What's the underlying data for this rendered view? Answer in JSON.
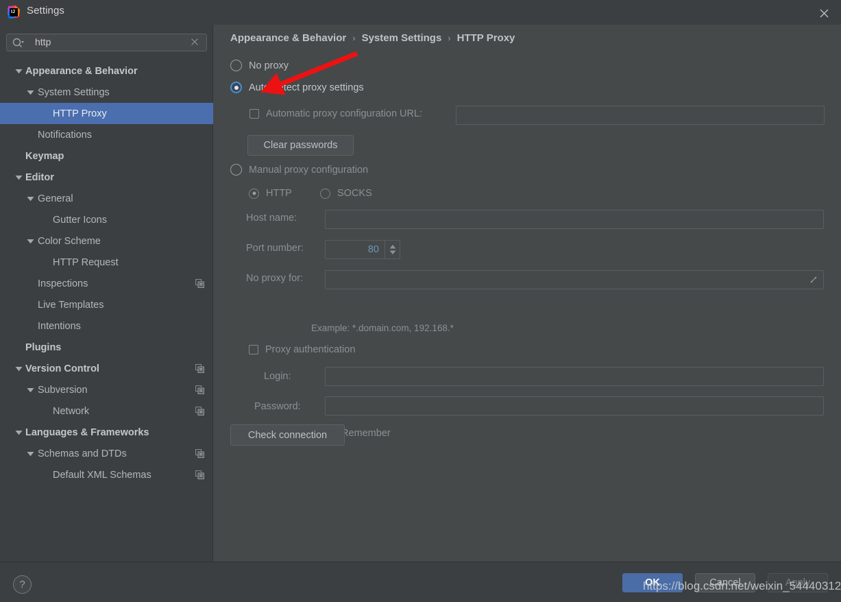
{
  "window": {
    "title": "Settings",
    "logo_icon": "intellij-idea-logo",
    "close_icon": "close-icon"
  },
  "search": {
    "value": "http",
    "placeholder": "",
    "search_icon": "search-icon",
    "clear_icon": "clear-icon"
  },
  "sidebar": {
    "items": [
      {
        "label": "Appearance & Behavior",
        "indent": 0,
        "twisty": "expanded",
        "bold": true,
        "selected": false,
        "copy": false
      },
      {
        "label": "System Settings",
        "indent": 1,
        "twisty": "expanded",
        "bold": false,
        "selected": false,
        "copy": false
      },
      {
        "label": "HTTP Proxy",
        "indent": 2,
        "twisty": "none",
        "bold": false,
        "selected": true,
        "copy": false
      },
      {
        "label": "Notifications",
        "indent": 1,
        "twisty": "none",
        "bold": false,
        "selected": false,
        "copy": false
      },
      {
        "label": "Keymap",
        "indent": 0,
        "twisty": "none",
        "bold": true,
        "selected": false,
        "copy": false
      },
      {
        "label": "Editor",
        "indent": 0,
        "twisty": "expanded",
        "bold": true,
        "selected": false,
        "copy": false
      },
      {
        "label": "General",
        "indent": 1,
        "twisty": "expanded",
        "bold": false,
        "selected": false,
        "copy": false
      },
      {
        "label": "Gutter Icons",
        "indent": 2,
        "twisty": "none",
        "bold": false,
        "selected": false,
        "copy": false
      },
      {
        "label": "Color Scheme",
        "indent": 1,
        "twisty": "expanded",
        "bold": false,
        "selected": false,
        "copy": false
      },
      {
        "label": "HTTP Request",
        "indent": 2,
        "twisty": "none",
        "bold": false,
        "selected": false,
        "copy": false
      },
      {
        "label": "Inspections",
        "indent": 1,
        "twisty": "none",
        "bold": false,
        "selected": false,
        "copy": true
      },
      {
        "label": "Live Templates",
        "indent": 1,
        "twisty": "none",
        "bold": false,
        "selected": false,
        "copy": false
      },
      {
        "label": "Intentions",
        "indent": 1,
        "twisty": "none",
        "bold": false,
        "selected": false,
        "copy": false
      },
      {
        "label": "Plugins",
        "indent": 0,
        "twisty": "none",
        "bold": true,
        "selected": false,
        "copy": false
      },
      {
        "label": "Version Control",
        "indent": 0,
        "twisty": "expanded",
        "bold": true,
        "selected": false,
        "copy": true
      },
      {
        "label": "Subversion",
        "indent": 1,
        "twisty": "expanded",
        "bold": false,
        "selected": false,
        "copy": true
      },
      {
        "label": "Network",
        "indent": 2,
        "twisty": "none",
        "bold": false,
        "selected": false,
        "copy": true
      },
      {
        "label": "Languages & Frameworks",
        "indent": 0,
        "twisty": "expanded",
        "bold": true,
        "selected": false,
        "copy": false
      },
      {
        "label": "Schemas and DTDs",
        "indent": 1,
        "twisty": "expanded",
        "bold": false,
        "selected": false,
        "copy": true
      },
      {
        "label": "Default XML Schemas",
        "indent": 2,
        "twisty": "none",
        "bold": false,
        "selected": false,
        "copy": true
      }
    ]
  },
  "breadcrumb": {
    "parts": [
      "Appearance & Behavior",
      "System Settings",
      "HTTP Proxy"
    ],
    "separator": "›"
  },
  "proxy": {
    "no_proxy_label": "No proxy",
    "no_proxy_selected": false,
    "auto_detect_label": "Auto-detect proxy settings",
    "auto_detect_selected": true,
    "auto_config_url_label": "Automatic proxy configuration URL:",
    "auto_config_url_checked": false,
    "auto_config_url_value": "",
    "clear_passwords_label": "Clear passwords",
    "manual_label": "Manual proxy configuration",
    "manual_selected": false,
    "http_label": "HTTP",
    "http_selected": true,
    "socks_label": "SOCKS",
    "socks_selected": false,
    "host_name_label": "Host name:",
    "host_name_value": "",
    "port_number_label": "Port number:",
    "port_number_value": "80",
    "no_proxy_for_label": "No proxy for:",
    "no_proxy_for_value": "",
    "no_proxy_for_expand_icon": "expand-icon",
    "example_text": "Example: *.domain.com, 192.168.*",
    "proxy_auth_label": "Proxy authentication",
    "proxy_auth_checked": false,
    "login_label": "Login:",
    "login_value": "",
    "password_label": "Password:",
    "password_value": "",
    "remember_label": "Remember",
    "remember_checked": false,
    "check_connection_label": "Check connection"
  },
  "footer": {
    "help_label": "?",
    "ok_label": "OK",
    "cancel_label": "Cancel",
    "apply_label": "Apply"
  },
  "annotation": {
    "arrow_color": "#ee1111",
    "watermark": "https://blog.csdn.net/weixin_54440312"
  },
  "colors": {
    "selection": "#4b6eaf",
    "ok_button": "#4a6da7",
    "window_bg": "#3c3f41",
    "panel_bg": "#45494a",
    "accent_radio": "#4b8ed6",
    "number_value": "#6897bb"
  }
}
